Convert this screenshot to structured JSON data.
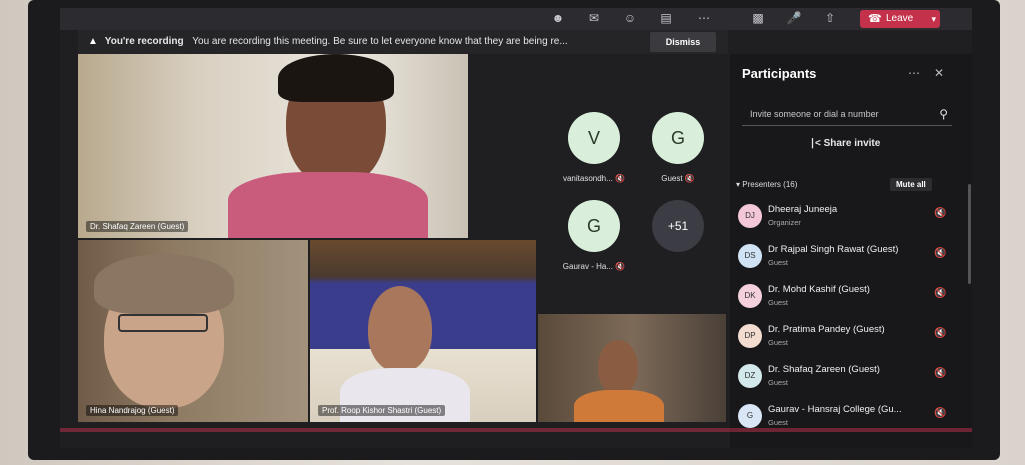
{
  "recording": {
    "title": "You're recording",
    "message": "You are recording this meeting. Be sure to let everyone know that they are being re...",
    "dismiss_label": "Dismiss"
  },
  "toolbar": {
    "leave_label": "Leave",
    "icons": [
      "people-icon",
      "chat-icon",
      "reactions-icon",
      "rooms-icon",
      "more-icon",
      "camera-icon",
      "mic-icon",
      "share-icon",
      "phone-icon"
    ]
  },
  "videos": [
    {
      "name": "Dr. Shafaq Zareen (Guest)"
    },
    {
      "name": "Hina Nandrajog (Guest)"
    },
    {
      "name": "Prof. Roop Kishor Shastri (Guest)"
    },
    {
      "name": ""
    }
  ],
  "avatars": [
    {
      "initial": "V",
      "label": "vanitasondh..."
    },
    {
      "initial": "G",
      "label": "Guest"
    },
    {
      "initial": "G",
      "label": "Gaurav - Ha..."
    },
    {
      "initial": "+51",
      "label": ""
    }
  ],
  "panel": {
    "title": "Participants",
    "invite_placeholder": "Invite someone or dial a number",
    "share_invite": "Share invite",
    "presenters_label": "Presenters (16)",
    "mute_all": "Mute all",
    "participants": [
      {
        "initials": "DJ",
        "name": "Dheeraj Juneeja",
        "role": "Organizer",
        "color": "#f4c7d8"
      },
      {
        "initials": "DS",
        "name": "Dr Rajpal Singh Rawat (Guest)",
        "role": "Guest",
        "color": "#cfe3f5"
      },
      {
        "initials": "DK",
        "name": "Dr. Mohd Kashif (Guest)",
        "role": "Guest",
        "color": "#f3d0dc"
      },
      {
        "initials": "DP",
        "name": "Dr. Pratima Pandey (Guest)",
        "role": "Guest",
        "color": "#f1dccf"
      },
      {
        "initials": "DZ",
        "name": "Dr. Shafaq Zareen (Guest)",
        "role": "Guest",
        "color": "#d3e8ea"
      },
      {
        "initials": "G",
        "name": "Gaurav - Hansraj College (Gu...",
        "role": "Guest",
        "color": "#d8e6f5"
      }
    ]
  },
  "colors": {
    "leave": "#c4314b",
    "avatar_bg": "#d9eedb",
    "panel_bg": "#18181b"
  }
}
